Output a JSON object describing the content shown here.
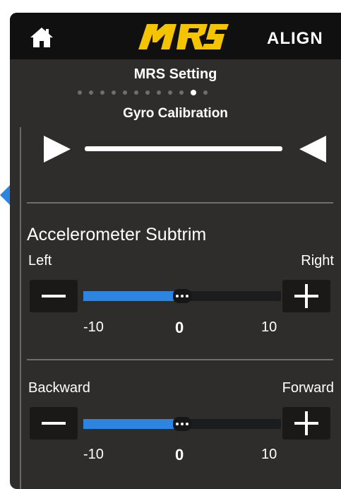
{
  "topbar": {
    "home_icon": "home-icon",
    "logo_text": "MRS",
    "brand": "ALIGN",
    "logo_color": "#f5c400"
  },
  "header": {
    "title": "MRS Setting",
    "page_count": 12,
    "active_page": 11
  },
  "gyro": {
    "title": "Gyro Calibration"
  },
  "accelerometer": {
    "title": "Accelerometer Subtrim",
    "rows": [
      {
        "left_label": "Left",
        "right_label": "Right",
        "min_label": "-10",
        "value_label": "0",
        "max_label": "10",
        "value": 0,
        "min": -10,
        "max": 10
      },
      {
        "left_label": "Backward",
        "right_label": "Forward",
        "min_label": "-10",
        "value_label": "0",
        "max_label": "10",
        "value": 0,
        "min": -10,
        "max": 10
      }
    ]
  },
  "colors": {
    "accent": "#2e85e0",
    "background": "#2e2d2c",
    "topbar": "#111010"
  }
}
